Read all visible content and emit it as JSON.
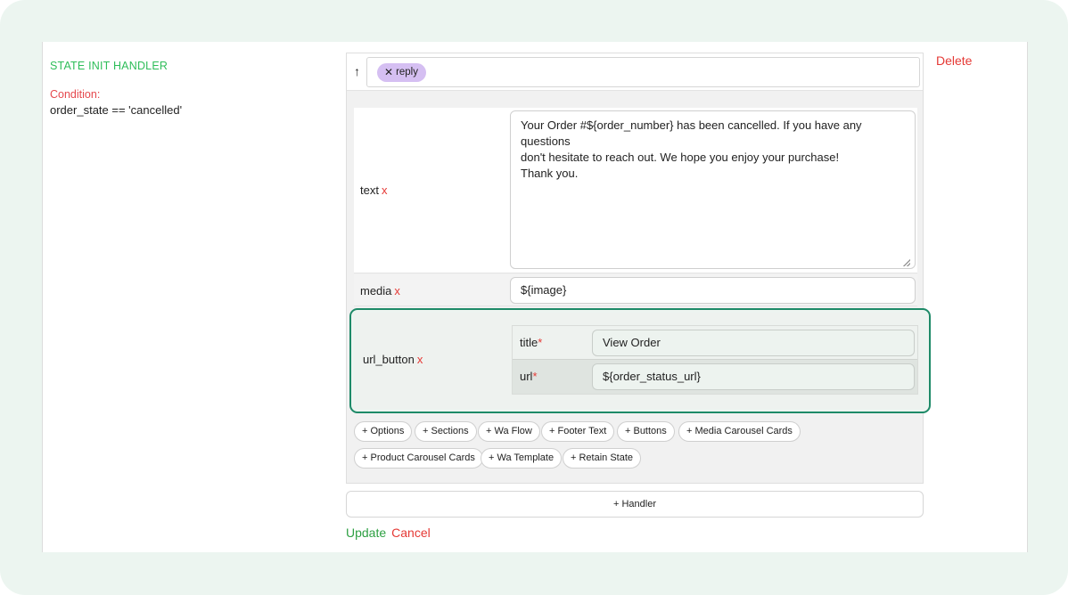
{
  "handler": {
    "title": "STATE INIT HANDLER",
    "condition_label": "Condition:",
    "condition_value": "order_state == 'cancelled'",
    "delete_label": "Delete"
  },
  "tags": {
    "arrow_glyph": "↑",
    "chip_remove_glyph": "✕",
    "chip_label": "reply"
  },
  "fields": {
    "remove_glyph": "x",
    "text": {
      "label": "text",
      "value": "Your Order #${order_number} has been cancelled. If you have any questions\ndon't hesitate to reach out. We hope you enjoy your purchase!\nThank you."
    },
    "media": {
      "label": "media",
      "value": "${image}"
    },
    "url_button": {
      "label": "url_button",
      "required_marker": "*",
      "title_label": "title",
      "title_value": "View Order",
      "url_label": "url",
      "url_value": "${order_status_url}"
    }
  },
  "add_buttons": [
    "+ Options",
    "+ Sections",
    "+ Wa Flow",
    "+ Footer Text",
    "+ Buttons",
    "+ Media Carousel Cards",
    "+ Product Carousel Cards",
    "+ Wa Template",
    "+ Retain State"
  ],
  "handler_button": "+ Handler",
  "footer": {
    "update_label": "Update",
    "cancel_label": "Cancel"
  },
  "colors": {
    "accent_green": "#2ebd59",
    "danger_red": "#e53935",
    "focus_border": "#1e8a68",
    "chip_purple": "#d5bff2"
  }
}
